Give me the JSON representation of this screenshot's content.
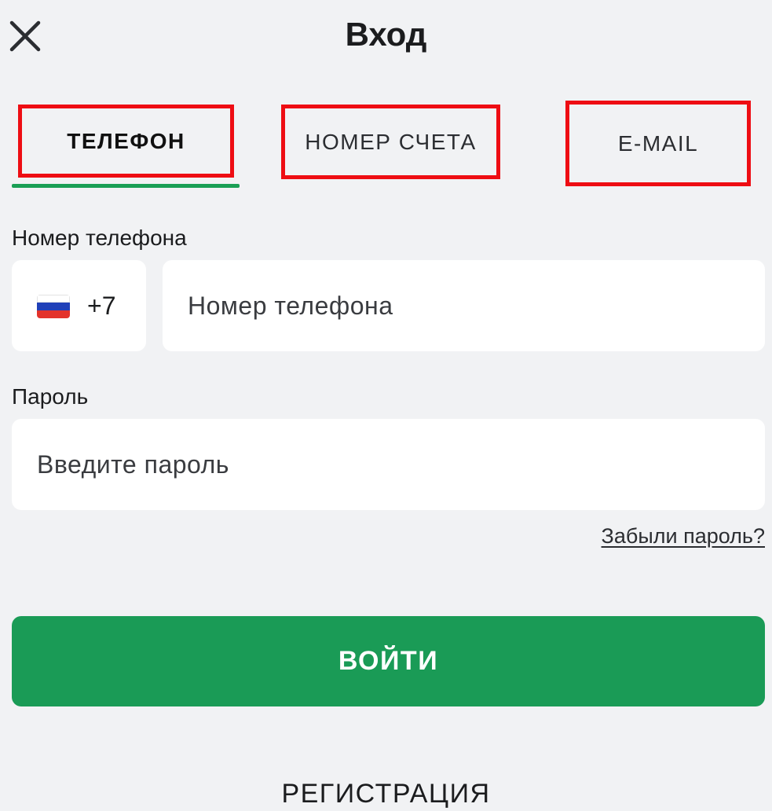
{
  "header": {
    "title": "Вход",
    "close_icon": "close-icon"
  },
  "tabs": [
    {
      "label": "ТЕЛЕФОН",
      "active": true
    },
    {
      "label": "НОМЕР СЧЕТА",
      "active": false
    },
    {
      "label": "E-MAIL",
      "active": false
    }
  ],
  "phone": {
    "label": "Номер телефона",
    "country_flag": "russia-flag-icon",
    "country_code": "+7",
    "placeholder": "Номер телефона",
    "value": ""
  },
  "password": {
    "label": "Пароль",
    "placeholder": "Введите пароль",
    "value": ""
  },
  "links": {
    "forgot_password": "Забыли пароль?"
  },
  "actions": {
    "login_label": "ВОЙТИ",
    "register_label": "РЕГИСТРАЦИЯ"
  },
  "colors": {
    "accent": "#1a9b56",
    "highlight_border": "#ee0d13",
    "background": "#f1f2f4"
  }
}
